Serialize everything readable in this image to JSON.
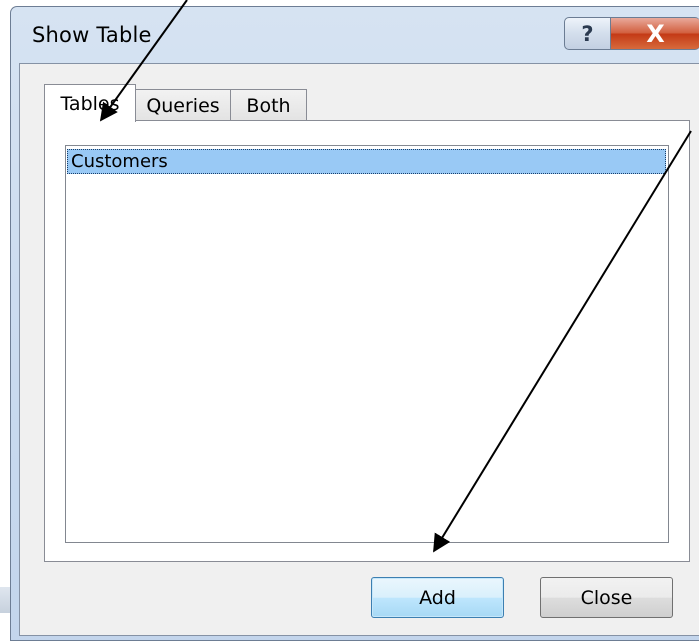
{
  "window": {
    "title": "Show Table",
    "help_glyph": "?",
    "close_glyph": "X"
  },
  "tabs": [
    {
      "label": "Tables",
      "active": true
    },
    {
      "label": "Queries",
      "active": false
    },
    {
      "label": "Both",
      "active": false
    }
  ],
  "list": {
    "items": [
      {
        "label": "Customers",
        "selected": true
      }
    ]
  },
  "buttons": {
    "add": "Add",
    "close": "Close"
  },
  "annotations": {
    "arrows": 2,
    "color": "#000000"
  },
  "colors": {
    "selection": "#99c9f5",
    "close_button": "#c43a16",
    "default_button": "#bee6fd"
  }
}
